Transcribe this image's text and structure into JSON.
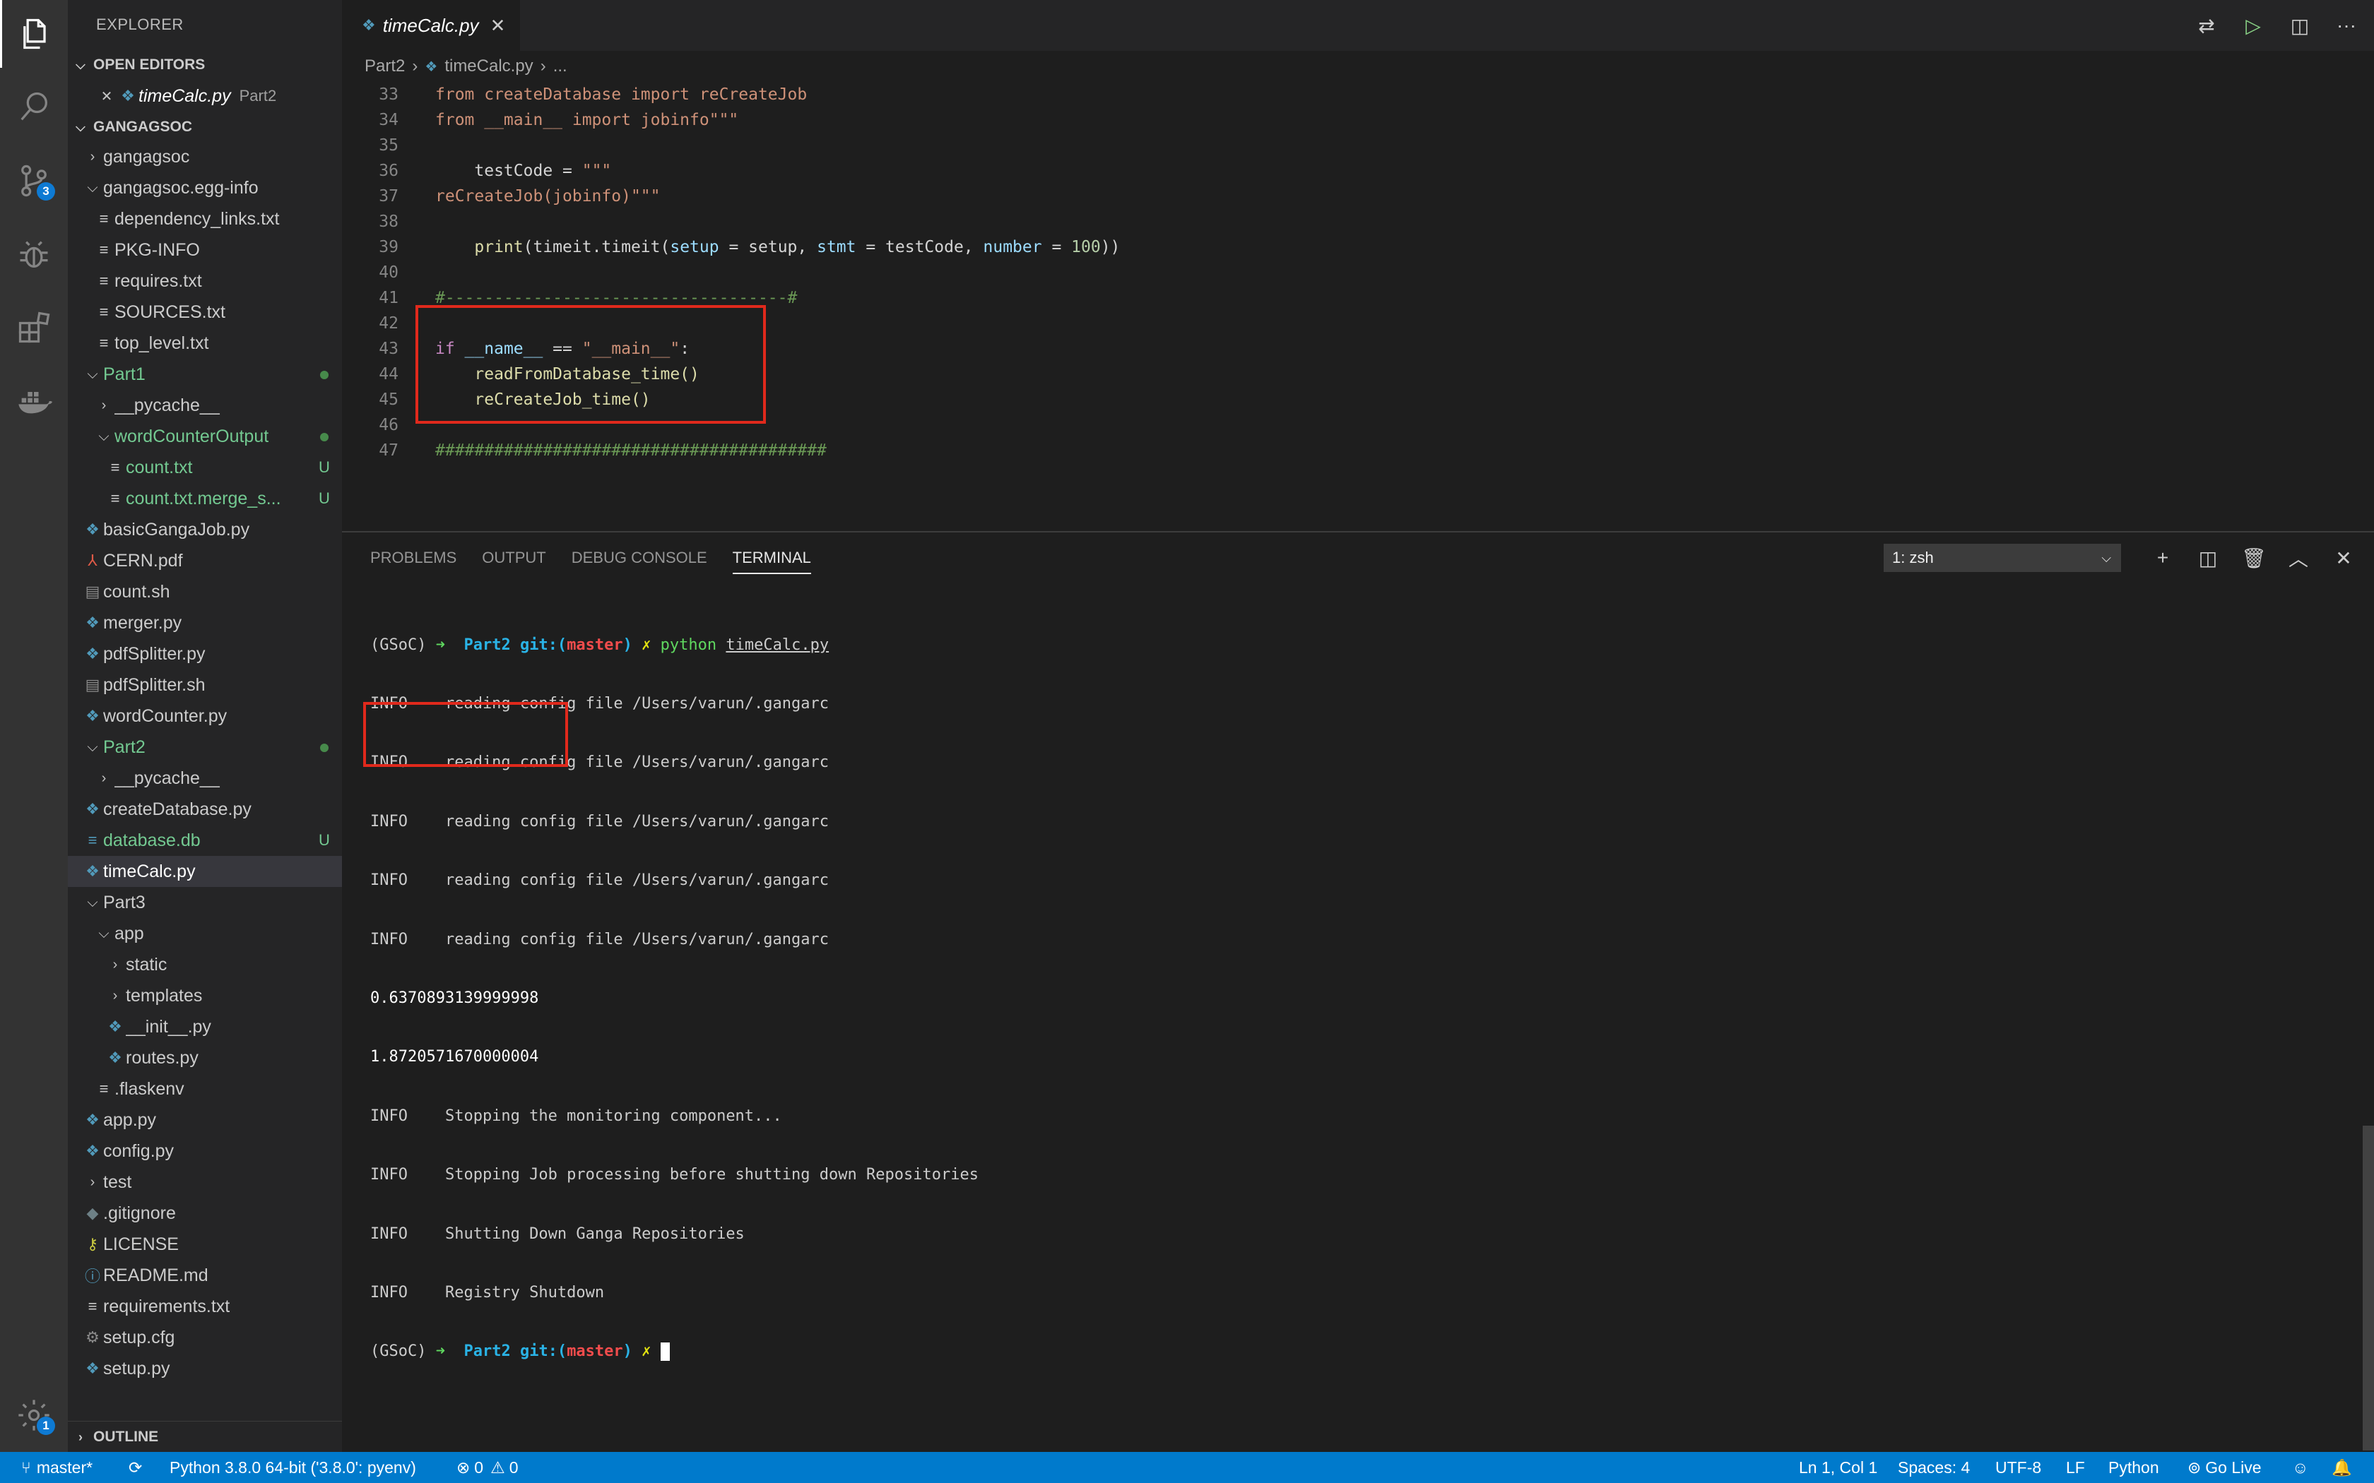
{
  "activity": {
    "source_control_badge": "3",
    "settings_badge": "1"
  },
  "sidebar": {
    "title": "EXPLORER",
    "open_editors_label": "OPEN EDITORS",
    "open_editor": {
      "name": "timeCalc.py",
      "folder": "Part2"
    },
    "workspace_label": "GANGAGSOC",
    "outline_label": "OUTLINE",
    "tree": [
      {
        "label": "gangagsoc",
        "status": ""
      },
      {
        "label": "gangagsoc.egg-info",
        "status": ""
      },
      {
        "label": "dependency_links.txt",
        "status": ""
      },
      {
        "label": "PKG-INFO",
        "status": ""
      },
      {
        "label": "requires.txt",
        "status": ""
      },
      {
        "label": "SOURCES.txt",
        "status": ""
      },
      {
        "label": "top_level.txt",
        "status": ""
      },
      {
        "label": "Part1",
        "status": ""
      },
      {
        "label": "__pycache__",
        "status": ""
      },
      {
        "label": "wordCounterOutput",
        "status": ""
      },
      {
        "label": "count.txt",
        "status": "U"
      },
      {
        "label": "count.txt.merge_s...",
        "status": "U"
      },
      {
        "label": "basicGangaJob.py",
        "status": ""
      },
      {
        "label": "CERN.pdf",
        "status": ""
      },
      {
        "label": "count.sh",
        "status": ""
      },
      {
        "label": "merger.py",
        "status": ""
      },
      {
        "label": "pdfSplitter.py",
        "status": ""
      },
      {
        "label": "pdfSplitter.sh",
        "status": ""
      },
      {
        "label": "wordCounter.py",
        "status": ""
      },
      {
        "label": "Part2",
        "status": ""
      },
      {
        "label": "__pycache__",
        "status": ""
      },
      {
        "label": "createDatabase.py",
        "status": ""
      },
      {
        "label": "database.db",
        "status": "U"
      },
      {
        "label": "timeCalc.py",
        "status": ""
      },
      {
        "label": "Part3",
        "status": ""
      },
      {
        "label": "app",
        "status": ""
      },
      {
        "label": "static",
        "status": ""
      },
      {
        "label": "templates",
        "status": ""
      },
      {
        "label": "__init__.py",
        "status": ""
      },
      {
        "label": "routes.py",
        "status": ""
      },
      {
        "label": ".flaskenv",
        "status": ""
      },
      {
        "label": "app.py",
        "status": ""
      },
      {
        "label": "config.py",
        "status": ""
      },
      {
        "label": "test",
        "status": ""
      },
      {
        "label": ".gitignore",
        "status": ""
      },
      {
        "label": "LICENSE",
        "status": ""
      },
      {
        "label": "README.md",
        "status": ""
      },
      {
        "label": "requirements.txt",
        "status": ""
      },
      {
        "label": "setup.cfg",
        "status": ""
      },
      {
        "label": "setup.py",
        "status": ""
      }
    ]
  },
  "editor": {
    "tab_label": "timeCalc.py",
    "breadcrumb": [
      "Part2",
      "timeCalc.py",
      "..."
    ],
    "line_numbers": [
      "33",
      "34",
      "35",
      "36",
      "37",
      "38",
      "39",
      "40",
      "41",
      "42",
      "43",
      "44",
      "45",
      "46",
      "47"
    ],
    "code": {
      "l33": "from createDatabase import reCreateJob",
      "l34": "from __main__ import jobinfo\"\"\"",
      "l36_a": "    testCode = ",
      "l36_b": "\"\"\"",
      "l37": "reCreateJob(jobinfo)\"\"\"",
      "l39_a": "    ",
      "l39_print": "print",
      "l39_b": "(timeit.timeit(",
      "l39_setup": "setup",
      "l39_c": " = setup, ",
      "l39_stmt": "stmt",
      "l39_d": " = testCode, ",
      "l39_number": "number",
      "l39_e": " = ",
      "l39_num": "100",
      "l39_f": "))",
      "l41": "#-----------------------------------#",
      "l43_if": "if",
      "l43_name": " __name__",
      "l43_eq": " == ",
      "l43_str": "\"__main__\"",
      "l43_colon": ":",
      "l44": "    readFromDatabase_time()",
      "l45": "    reCreateJob_time()",
      "l47": "########################################"
    }
  },
  "panel": {
    "tabs": [
      "PROBLEMS",
      "OUTPUT",
      "DEBUG CONSOLE",
      "TERMINAL"
    ],
    "terminal_select": "1: zsh",
    "terminal": {
      "prompt_env": "(GSoC) ",
      "prompt_arrow": "➜  ",
      "prompt_dir": "Part2 ",
      "prompt_git": "git:(",
      "prompt_branch": "master",
      "prompt_git_close": ") ",
      "prompt_x": "✗ ",
      "cmd": "python ",
      "cmd_arg": "timeCalc.py",
      "info_lines": [
        "INFO    reading config file /Users/varun/.gangarc",
        "INFO    reading config file /Users/varun/.gangarc",
        "INFO    reading config file /Users/varun/.gangarc",
        "INFO    reading config file /Users/varun/.gangarc",
        "INFO    reading config file /Users/varun/.gangarc"
      ],
      "results": [
        "0.6370893139999998",
        "1.8720571670000004"
      ],
      "shutdown_lines": [
        "INFO    Stopping the monitoring component...",
        "INFO    Stopping Job processing before shutting down Repositories",
        "INFO    Shutting Down Ganga Repositories",
        "INFO    Registry Shutdown"
      ]
    }
  },
  "status": {
    "branch": "master*",
    "python": "Python 3.8.0 64-bit ('3.8.0': pyenv)",
    "errors": "0",
    "warnings": "0",
    "position": "Ln 1, Col 1",
    "spaces": "Spaces: 4",
    "encoding": "UTF-8",
    "eol": "LF",
    "language": "Python",
    "golive": "Go Live"
  },
  "colors": {
    "status_bar": "#007acc",
    "highlight_box": "#e0291c",
    "activity_bar": "#333333",
    "sidebar": "#252526",
    "editor": "#1e1e1e"
  }
}
